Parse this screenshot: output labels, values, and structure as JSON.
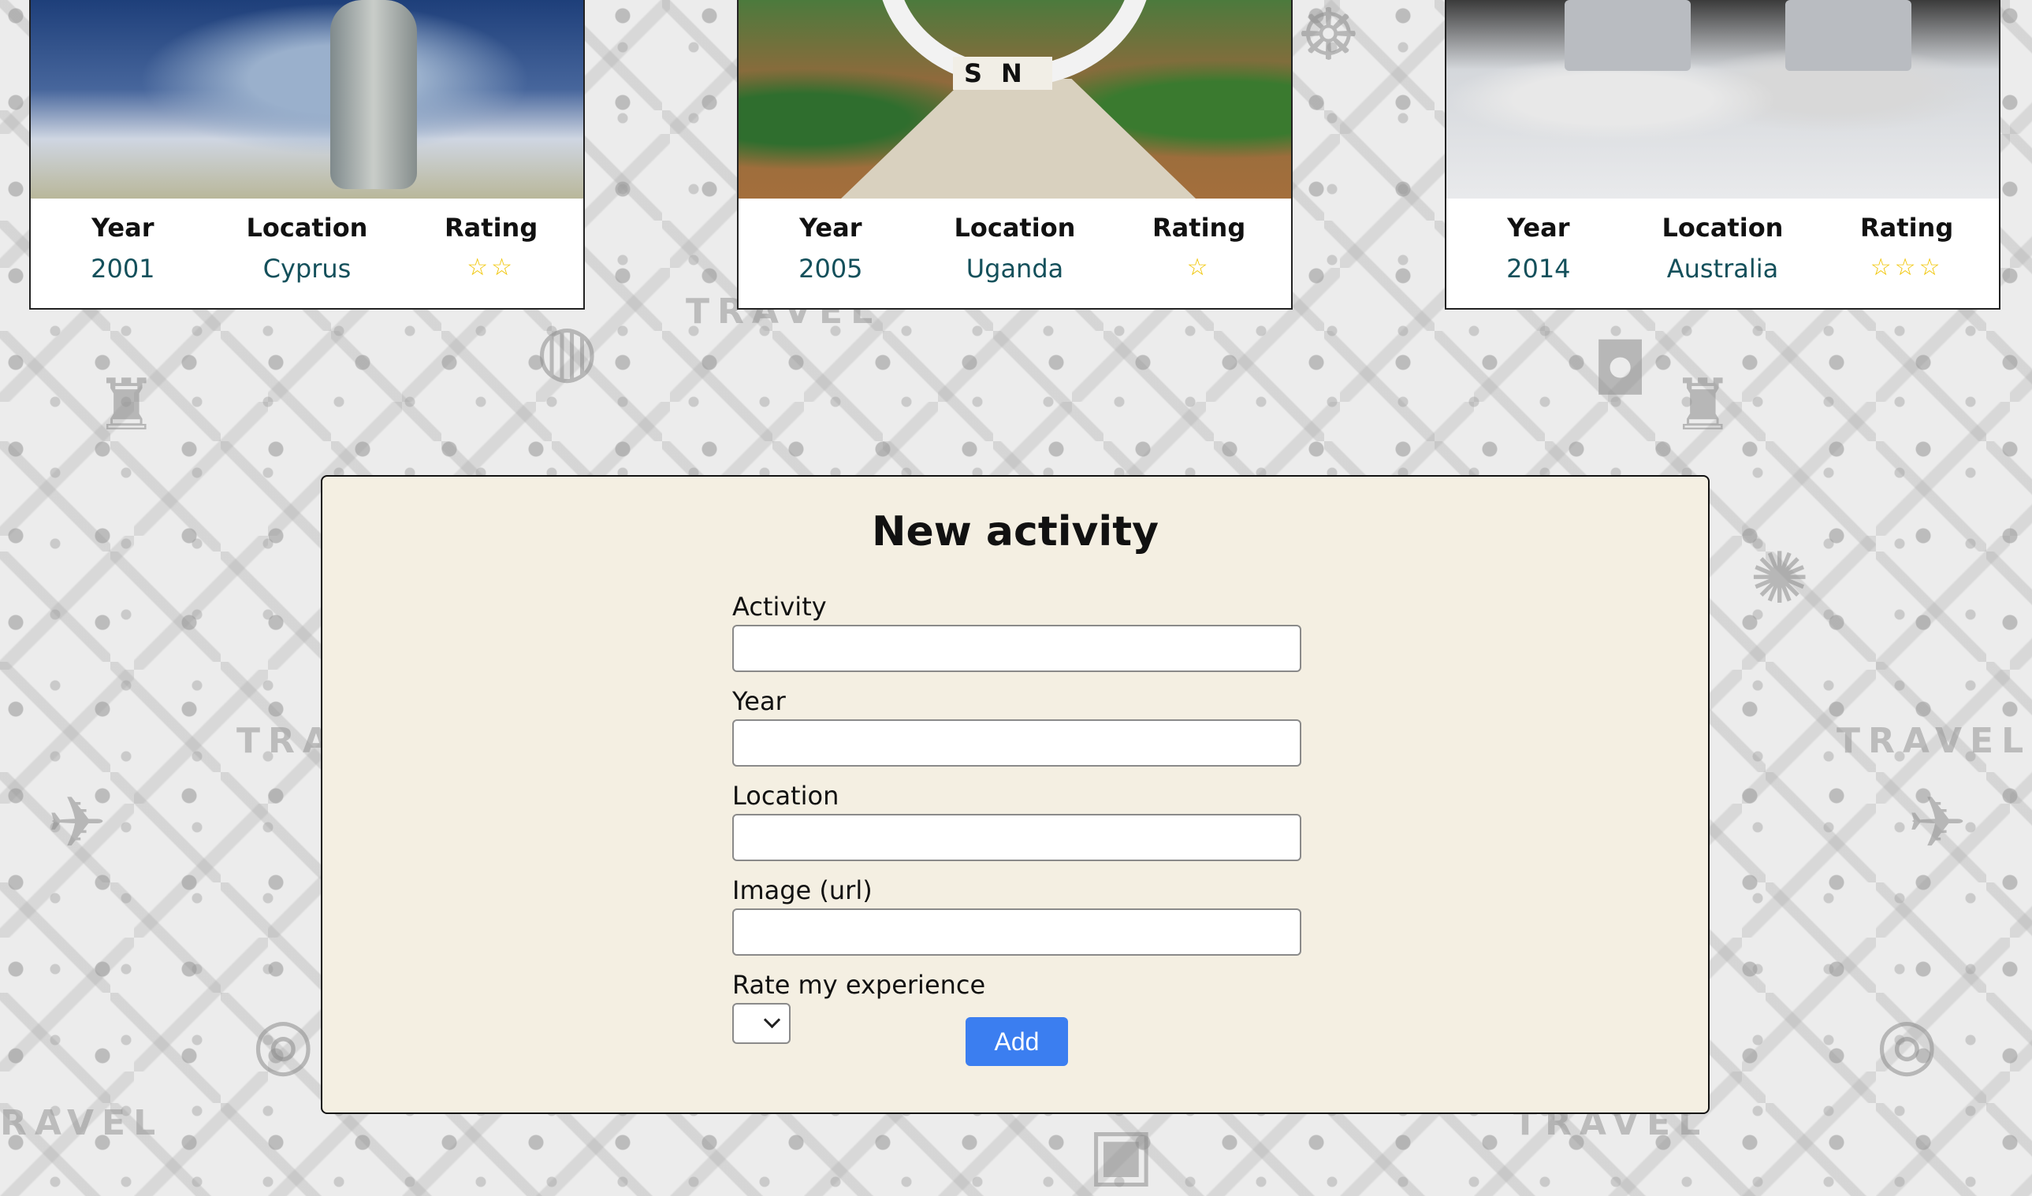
{
  "background": {
    "watermark_text": "TRAVEL"
  },
  "cards": [
    {
      "image_name": "underwater-statue-image",
      "year_label": "Year",
      "year": "2001",
      "location_label": "Location",
      "location": "Cyprus",
      "rating_label": "Rating",
      "rating_stars": "☆☆",
      "rating_value": 2
    },
    {
      "image_name": "equator-monument-image",
      "image_text": "SN",
      "year_label": "Year",
      "year": "2005",
      "location_label": "Location",
      "location": "Uganda",
      "rating_label": "Rating",
      "rating_stars": "☆",
      "rating_value": 1
    },
    {
      "image_name": "office-laptops-image",
      "year_label": "Year",
      "year": "2014",
      "location_label": "Location",
      "location": "Australia",
      "rating_label": "Rating",
      "rating_stars": "☆☆☆",
      "rating_value": 3
    }
  ],
  "form": {
    "title": "New activity",
    "activity_label": "Activity",
    "activity_value": "",
    "year_label": "Year",
    "year_value": "",
    "location_label": "Location",
    "location_value": "",
    "image_label": "Image (url)",
    "image_value": "",
    "rating_label": "Rate my experience",
    "rating_selected": "",
    "add_label": "Add"
  },
  "colors": {
    "panel_bg": "#f4efe2",
    "button_blue": "#3b7ef0",
    "star_gold": "#f0c400",
    "value_teal": "#14505b"
  }
}
